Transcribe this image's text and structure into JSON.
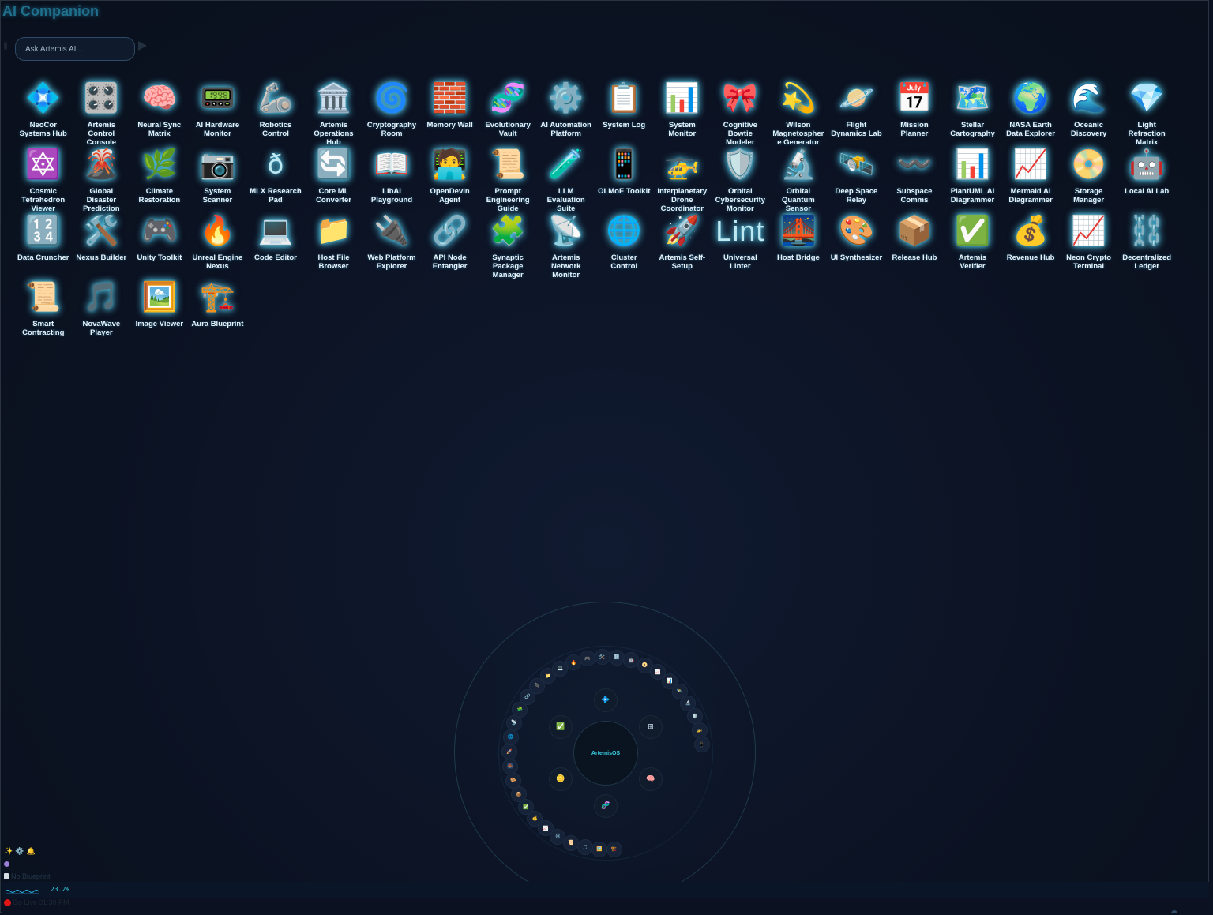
{
  "window": {
    "title": "AI Companion"
  },
  "assistant": {
    "placeholder": "Ask Artemis AI..."
  },
  "apps": [
    {
      "label": "NeoCor Systems Hub",
      "icon": "💠",
      "icon_name": "diamond-icon"
    },
    {
      "label": "Artemis Control Console",
      "icon": "🎛️",
      "icon_name": "control-knobs-icon"
    },
    {
      "label": "Neural Sync Matrix",
      "icon": "🧠",
      "icon_name": "brain-icon"
    },
    {
      "label": "AI Hardware Monitor",
      "icon": "📟",
      "icon_name": "pager-icon"
    },
    {
      "label": "Robotics Control",
      "icon": "🦾",
      "icon_name": "mechanical-arm-icon"
    },
    {
      "label": "Artemis Operations Hub",
      "icon": "🏛️",
      "icon_name": "classical-building-icon"
    },
    {
      "label": "Cryptography Room",
      "icon": "🌀",
      "icon_name": "cyclone-icon"
    },
    {
      "label": "Memory Wall",
      "icon": "🧱",
      "icon_name": "bricks-icon"
    },
    {
      "label": "Evolutionary Vault",
      "icon": "🧬",
      "icon_name": "dna-icon"
    },
    {
      "label": "AI Automation Platform",
      "icon": "⚙️",
      "icon_name": "gear-icon"
    },
    {
      "label": "System Log",
      "icon": "📋",
      "icon_name": "clipboard-icon"
    },
    {
      "label": "System Monitor",
      "icon": "📊",
      "icon_name": "bar-chart-icon"
    },
    {
      "label": "Cognitive Bowtie Modeler",
      "icon": "🎀",
      "icon_name": "ribbon-icon"
    },
    {
      "label": "Wilson Magnetosphere Generator",
      "icon": "💫",
      "icon_name": "orbit-icon"
    },
    {
      "label": "Flight Dynamics Lab",
      "icon": "🪐",
      "icon_name": "ringed-planet-icon"
    },
    {
      "label": "Mission Planner",
      "icon": "📅",
      "icon_name": "calendar-icon"
    },
    {
      "label": "Stellar Cartography",
      "icon": "🗺️",
      "icon_name": "world-map-icon"
    },
    {
      "label": "NASA Earth Data Explorer",
      "icon": "🌍",
      "icon_name": "globe-icon"
    },
    {
      "label": "Oceanic Discovery",
      "icon": "🌊",
      "icon_name": "wave-icon"
    },
    {
      "label": "Light Refraction Matrix",
      "icon": "💎",
      "icon_name": "gem-icon"
    },
    {
      "label": "Cosmic Tetrahedron Viewer",
      "icon": "🔯",
      "icon_name": "star-of-david-icon"
    },
    {
      "label": "Global Disaster Prediction",
      "icon": "🌋",
      "icon_name": "volcano-icon"
    },
    {
      "label": "Climate Restoration",
      "icon": "🌿",
      "icon_name": "herb-icon"
    },
    {
      "label": "System Scanner",
      "icon": "📷",
      "icon_name": "camera-icon"
    },
    {
      "label": "MLX Research Pad",
      "icon": "ð",
      "icon_name": "eth-glyph-icon",
      "glyph": true
    },
    {
      "label": "Core ML Converter",
      "icon": "🔄",
      "icon_name": "refresh-icon"
    },
    {
      "label": "LibAI Playground",
      "icon": "📖",
      "icon_name": "open-book-icon"
    },
    {
      "label": "OpenDevin Agent",
      "icon": "🧑‍💻",
      "icon_name": "technologist-icon"
    },
    {
      "label": "Prompt Engineering Guide",
      "icon": "📜",
      "icon_name": "scroll-icon"
    },
    {
      "label": "LLM Evaluation Suite",
      "icon": "🧪",
      "icon_name": "test-tube-icon"
    },
    {
      "label": "OLMoE Toolkit",
      "icon": "📱",
      "icon_name": "mobile-phone-icon"
    },
    {
      "label": "Interplanetary Drone Coordinator",
      "icon": "🚁",
      "icon_name": "helicopter-icon"
    },
    {
      "label": "Orbital Cybersecurity Monitor",
      "icon": "🛡️",
      "icon_name": "shield-icon"
    },
    {
      "label": "Orbital Quantum Sensor",
      "icon": "🔬",
      "icon_name": "microscope-icon"
    },
    {
      "label": "Deep Space Relay",
      "icon": "🛰️",
      "icon_name": "satellite-icon"
    },
    {
      "label": "Subspace Comms",
      "icon": "〰️",
      "icon_name": "wavy-dash-icon"
    },
    {
      "label": "PlantUML AI Diagrammer",
      "icon": "📊",
      "icon_name": "bar-chart-icon"
    },
    {
      "label": "Mermaid AI Diagrammer",
      "icon": "📈",
      "icon_name": "chart-increasing-icon"
    },
    {
      "label": "Storage Manager",
      "icon": "📀",
      "icon_name": "dvd-icon"
    },
    {
      "label": "Local AI Lab",
      "icon": "🤖",
      "icon_name": "robot-icon"
    },
    {
      "label": "Data Cruncher",
      "icon": "🔢",
      "icon_name": "numbers-icon"
    },
    {
      "label": "Nexus Builder",
      "icon": "🛠️",
      "icon_name": "hammer-wrench-icon"
    },
    {
      "label": "Unity Toolkit",
      "icon": "🎮",
      "icon_name": "game-controller-icon"
    },
    {
      "label": "Unreal Engine Nexus",
      "icon": "🔥",
      "icon_name": "fire-icon"
    },
    {
      "label": "Code Editor",
      "icon": "💻",
      "icon_name": "laptop-icon"
    },
    {
      "label": "Host File Browser",
      "icon": "📁",
      "icon_name": "folder-icon"
    },
    {
      "label": "Web Platform Explorer",
      "icon": "🔌",
      "icon_name": "plug-icon"
    },
    {
      "label": "API Node Entangler",
      "icon": "🔗",
      "icon_name": "link-icon"
    },
    {
      "label": "Synaptic Package Manager",
      "icon": "🧩",
      "icon_name": "puzzle-icon"
    },
    {
      "label": "Artemis Network Monitor",
      "icon": "📡",
      "icon_name": "satellite-antenna-icon"
    },
    {
      "label": "Cluster Control",
      "icon": "🌐",
      "icon_name": "globe-meridians-icon"
    },
    {
      "label": "Artemis Self-Setup",
      "icon": "🚀",
      "icon_name": "rocket-icon"
    },
    {
      "label": "Universal Linter",
      "icon": "Lint",
      "icon_name": "lint-text-icon",
      "lint": true
    },
    {
      "label": "Host Bridge",
      "icon": "🌉",
      "icon_name": "bridge-icon"
    },
    {
      "label": "UI Synthesizer",
      "icon": "🎨",
      "icon_name": "palette-icon"
    },
    {
      "label": "Release Hub",
      "icon": "📦",
      "icon_name": "package-icon"
    },
    {
      "label": "Artemis Verifier",
      "icon": "✅",
      "icon_name": "check-mark-icon"
    },
    {
      "label": "Revenue Hub",
      "icon": "💰",
      "icon_name": "money-bag-icon"
    },
    {
      "label": "Neon Crypto Terminal",
      "icon": "📈",
      "icon_name": "chart-increasing-icon"
    },
    {
      "label": "Decentralized Ledger",
      "icon": "⛓️",
      "icon_name": "chains-icon"
    },
    {
      "label": "Smart Contracting",
      "icon": "📜",
      "icon_name": "scroll-icon"
    },
    {
      "label": "NovaWave Player",
      "icon": "🎵",
      "icon_name": "music-note-icon"
    },
    {
      "label": "Image Viewer",
      "icon": "🖼️",
      "icon_name": "framed-picture-icon"
    },
    {
      "label": "Aura Blueprint",
      "icon": "🏗️",
      "icon_name": "construction-icon"
    }
  ],
  "orbit": {
    "hub_label": "ArtemisOS",
    "inner_nodes": [
      {
        "icon": "💠",
        "name": "orbit-node-diamond"
      },
      {
        "icon": "⊞",
        "name": "orbit-node-grid"
      },
      {
        "icon": "🧠",
        "name": "orbit-node-brain"
      },
      {
        "icon": "🧬",
        "name": "orbit-node-dna"
      },
      {
        "icon": "🪙",
        "name": "orbit-node-coin"
      },
      {
        "icon": "✅",
        "name": "orbit-node-check"
      }
    ]
  },
  "footer": {
    "status_icons": [
      "✨",
      "⚙️",
      "🔔"
    ],
    "blueprint_text": "No Blueprint",
    "percent": "23.2%",
    "go_live": "Go Live",
    "clock": "01:30 PM"
  }
}
